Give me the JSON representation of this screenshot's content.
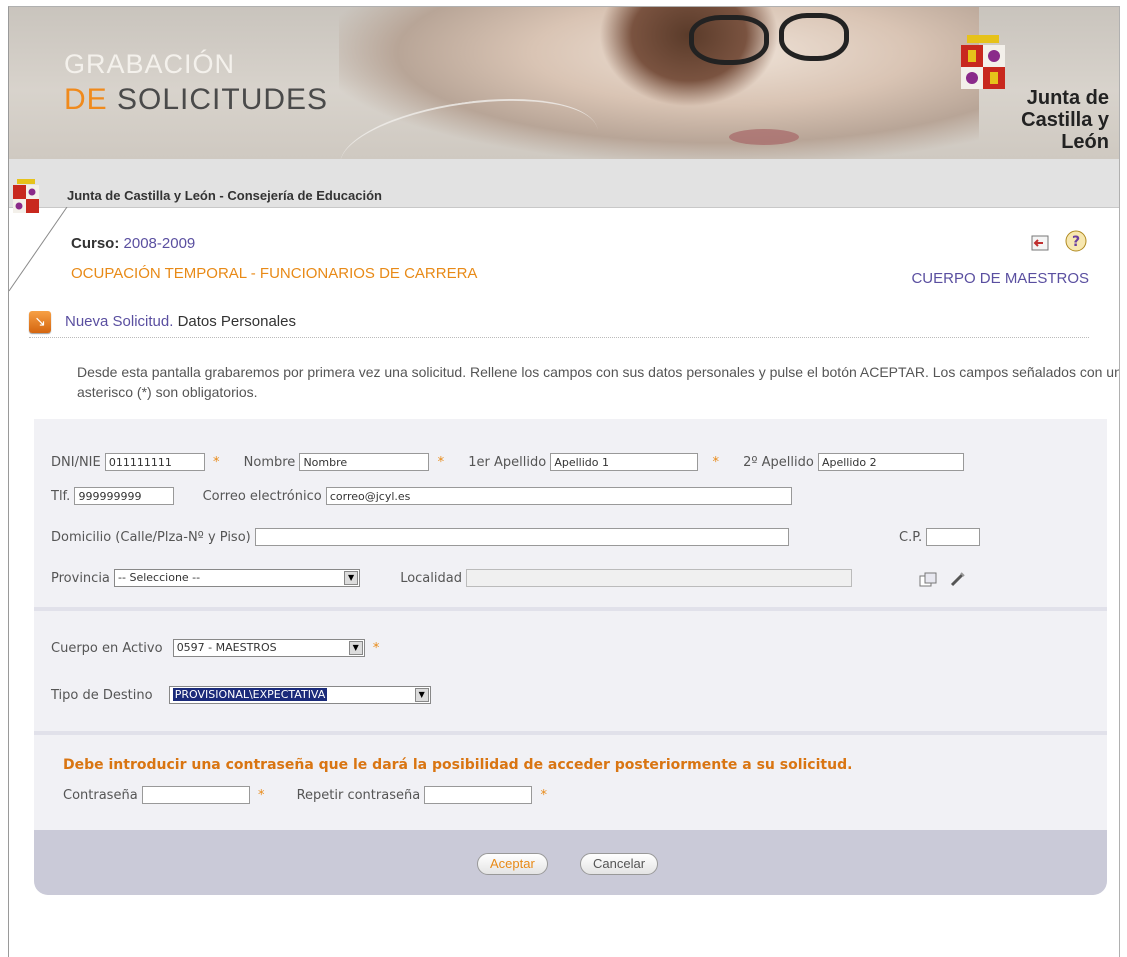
{
  "banner": {
    "title_line1": "GRABACIÓN",
    "title_de": "DE",
    "title_rest": "SOLICITUDES",
    "org_line1": "Junta de",
    "org_line2": "Castilla y León"
  },
  "strip": {
    "text": "Junta de Castilla y León - Consejería de Educación"
  },
  "header": {
    "curso_label": "Curso:",
    "curso_value": "2008-2009",
    "ocupacion": "OCUPACIÓN TEMPORAL - FUNCIONARIOS DE CARRERA",
    "cuerpo": "CUERPO DE MAESTROS"
  },
  "section": {
    "title_highlight": "Nueva Solicitud.",
    "title_rest": "Datos Personales",
    "intro": "Desde esta pantalla grabaremos por primera vez una solicitud. Rellene los campos con sus datos personales y pulse el botón ACEPTAR. Los campos señalados con un asterisco (*) son obligatorios."
  },
  "form": {
    "asterisk": "*",
    "dni_label": "DNI/NIE",
    "dni_value": "011111111",
    "nombre_label": "Nombre",
    "nombre_value": "Nombre",
    "apellido1_label": "1er Apellido",
    "apellido1_value": "Apellido 1",
    "apellido2_label": "2º Apellido",
    "apellido2_value": "Apellido 2",
    "tlf_label": "Tlf.",
    "tlf_value": "999999999",
    "correo_label": "Correo electrónico",
    "correo_value": "correo@jcyl.es",
    "domicilio_label": "Domicilio (Calle/Plza-Nº y Piso)",
    "domicilio_value": "",
    "cp_label": "C.P.",
    "cp_value": "",
    "provincia_label": "Provincia",
    "provincia_value": "-- Seleccione --",
    "localidad_label": "Localidad",
    "localidad_value": "",
    "cuerpo_label": "Cuerpo en Activo",
    "cuerpo_value": "0597 - MAESTROS",
    "destino_label": "Tipo de Destino",
    "destino_value": "PROVISIONAL\\EXPECTATIVA",
    "warning": "Debe introducir una contraseña que le dará la posibilidad de acceder posteriormente a su solicitud.",
    "pass_label": "Contraseña",
    "pass_value": "",
    "pass2_label": "Repetir contraseña",
    "pass2_value": ""
  },
  "buttons": {
    "ok": "Aceptar",
    "cancel": "Cancelar"
  },
  "colors": {
    "accent_orange": "#e88a17",
    "accent_purple": "#5a4fa0",
    "panel": "#f1f1f5",
    "footer": "#cacad8"
  }
}
